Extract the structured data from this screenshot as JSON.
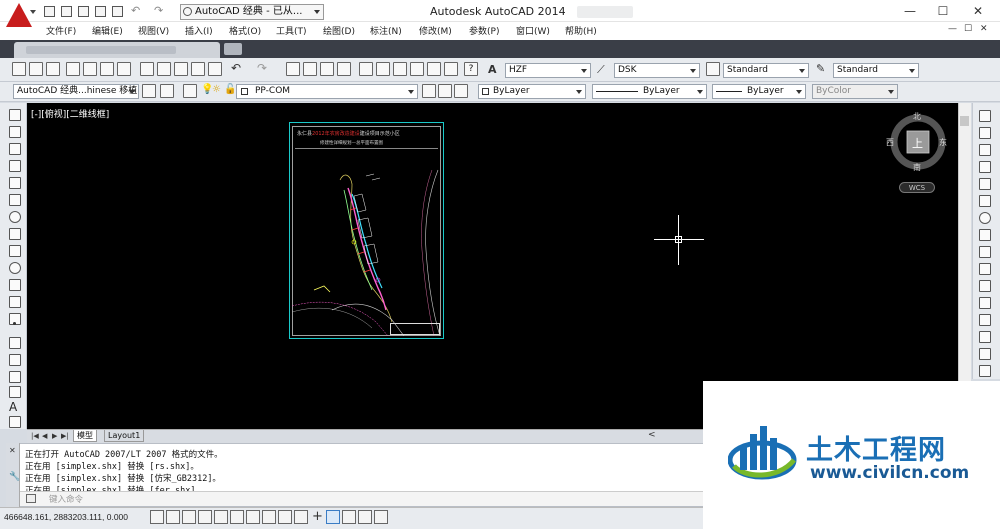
{
  "title_bar": {
    "workspace": "AutoCAD 经典 - 已从...",
    "app_title": "Autodesk AutoCAD 2014",
    "minimize": "—",
    "maximize": "☐",
    "close": "✕"
  },
  "menu": {
    "items": [
      "文件(F)",
      "编辑(E)",
      "视图(V)",
      "插入(I)",
      "格式(O)",
      "工具(T)",
      "绘图(D)",
      "标注(N)",
      "修改(M)",
      "参数(P)",
      "窗口(W)",
      "帮助(H)"
    ],
    "mdi_controls": [
      "—",
      "☐",
      "✕"
    ]
  },
  "toolbar": {
    "text_style": "HZF",
    "dim_style": "DSK",
    "table_style": "Standard",
    "multileader_style": "Standard",
    "workspace_combo": "AutoCAD 经典...hinese 移植",
    "layer": "PP-COM",
    "color": "ByLayer",
    "linetype": "ByLayer",
    "lineweight": "ByLayer",
    "plot_style": "ByColor"
  },
  "viewport": {
    "label": "[-][俯视][二维线框]",
    "viewcube": {
      "north": "北",
      "south": "南",
      "east": "东",
      "west": "西",
      "face": "上"
    },
    "wcs": "WCS"
  },
  "drawing_sheet": {
    "title_prefix": "永仁县",
    "title_red": "2012年农房改造建设",
    "title_suffix": "建设项目示范小区",
    "subtitle": "修建性详细规划—总平面布置图"
  },
  "layout_tabs": {
    "nav": [
      "|◀",
      "◀",
      "▶",
      "▶|"
    ],
    "tabs": [
      "模型",
      "Layout1"
    ],
    "hscroll_left": "<"
  },
  "command": {
    "history": [
      "正在打开 AutoCAD 2007/LT 2007 格式的文件。",
      "正在用 [simplex.shx] 替换 [rs.shx]。",
      "正在用 [simplex.shx] 替换 [仿宋_GB2312]。",
      "正在用 [simplex.shx] 替换 [fer.shx]。"
    ],
    "placeholder": "键入命令"
  },
  "status": {
    "coordinates": "466648.161, 2883203.111, 0.000"
  },
  "watermark": {
    "title": "土木工程网",
    "url": "www.civilcn.com",
    "colors": {
      "blue": "#1a6fb5",
      "green": "#78b82a"
    }
  },
  "colors": {
    "canvas": "#000000",
    "sheet_border": "#1ac9c9",
    "brand_red": "#c81d1d"
  }
}
